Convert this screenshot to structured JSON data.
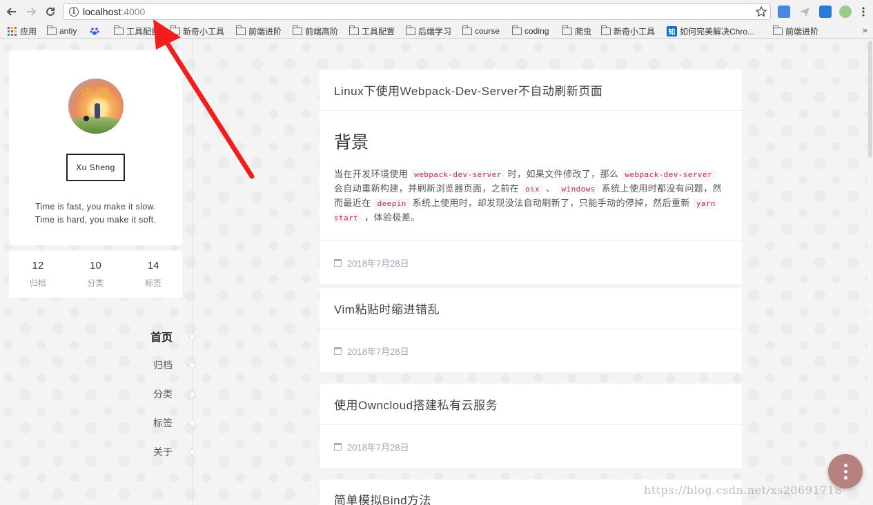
{
  "browser": {
    "url_host": "localhost",
    "url_port": ":4000",
    "bookmarks": [
      {
        "label": "应用",
        "type": "apps"
      },
      {
        "label": "antiy",
        "type": "folder"
      },
      {
        "label": "",
        "type": "baidu"
      },
      {
        "label": "工具配置",
        "type": "folder"
      },
      {
        "label": "新奇小工具",
        "type": "folder"
      },
      {
        "label": "前端进阶",
        "type": "folder"
      },
      {
        "label": "前端高阶",
        "type": "folder"
      },
      {
        "label": "工具配置",
        "type": "folder"
      },
      {
        "label": "后端学习",
        "type": "folder"
      },
      {
        "label": "course",
        "type": "folder"
      },
      {
        "label": "coding",
        "type": "folder"
      },
      {
        "label": "爬虫",
        "type": "folder"
      },
      {
        "label": "新奇小工具",
        "type": "folder"
      },
      {
        "label": "如何完美解决Chro...",
        "type": "zhihu"
      },
      {
        "label": "前端进阶",
        "type": "folder"
      }
    ],
    "more": "»",
    "zhihu_glyph": "知"
  },
  "profile": {
    "avatar_text": "许 盛",
    "name": "Xu Sheng",
    "motto_line1": "Time is fast, you make it slow.",
    "motto_line2": "Time is hard, you make it soft."
  },
  "stats": [
    {
      "num": "12",
      "label": "归档"
    },
    {
      "num": "10",
      "label": "分类"
    },
    {
      "num": "14",
      "label": "标签"
    }
  ],
  "menu": [
    {
      "label": "首页",
      "active": true
    },
    {
      "label": "归档",
      "active": false
    },
    {
      "label": "分类",
      "active": false
    },
    {
      "label": "标签",
      "active": false
    },
    {
      "label": "关于",
      "active": false
    }
  ],
  "posts": [
    {
      "title": "Linux下使用Webpack-Dev-Server不自动刷新页面",
      "heading": "背景",
      "p": {
        "t1": "当在开发环境使用",
        "c1": "webpack-dev-server",
        "t2": "时，如果文件修改了，那么",
        "c2": "webpack-dev-server",
        "t3": "会自动重新构建，并刷新浏览器页面，之前在",
        "c3": "osx",
        "t4": "、",
        "c4": "windows",
        "t5": "系统上使用时都没有问题，然而最近在",
        "c5": "deepin",
        "t6": "系统上使用时，却发现没法自动刷新了，只能手动的停掉，然后重新",
        "c6": "yarn start",
        "t7": "，体验极差。"
      },
      "date": "2018年7月28日"
    },
    {
      "title": "Vim粘贴时缩进错乱",
      "date": "2018年7月28日"
    },
    {
      "title": "使用Owncloud搭建私有云服务",
      "date": "2018年7月28日"
    },
    {
      "title": "简单模拟Bind方法"
    }
  ],
  "watermark": "https://blog.csdn.net/xs20691718",
  "colors": {
    "accent_arrow": "#f21d1d",
    "fab": "#b98080",
    "code": "#c7254e"
  }
}
